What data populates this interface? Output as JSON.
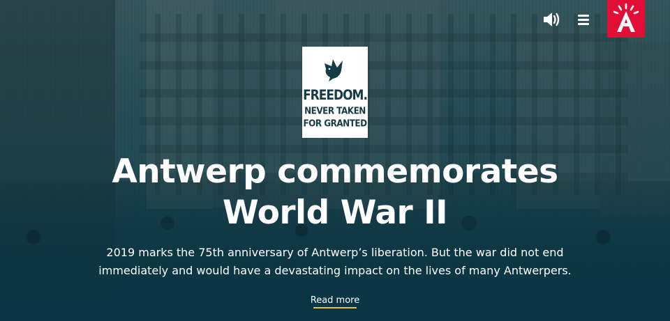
{
  "header": {
    "sound_icon": "speaker-volume-icon",
    "menu_icon": "hamburger-menu-icon",
    "logo": "antwerp-a-logo",
    "logo_color": "#e20e36"
  },
  "badge": {
    "icon": "dove-icon",
    "line1": "FREEDOM.",
    "line2": "NEVER TAKEN",
    "line3": "FOR GRANTED"
  },
  "hero": {
    "title_line1": "Antwerp commemorates",
    "title_line2": "World War II",
    "subtext_line1": "2019 marks the 75th anniversary of Antwerp’s liberation. But the war did not end",
    "subtext_line2": "immediately and would have a devastating impact on the lives of many Antwerpers.",
    "read_more": "Read more",
    "accent": "#f0c21a"
  }
}
